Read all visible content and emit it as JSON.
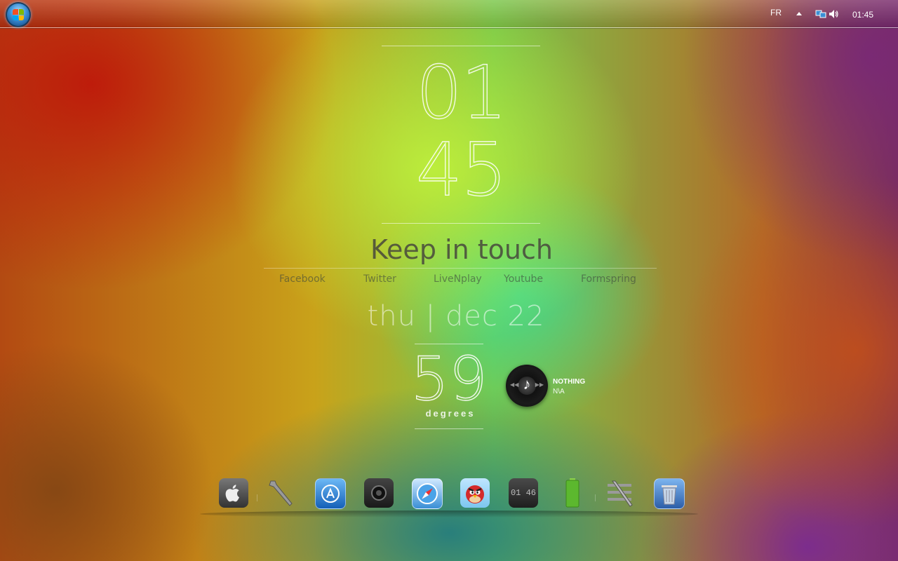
{
  "taskbar": {
    "language": "FR",
    "clock": "01:45",
    "icons": [
      "show-hidden-icons-arrow-icon",
      "network-icon",
      "volume-icon"
    ]
  },
  "clock": {
    "hours": "01",
    "minutes": "45"
  },
  "social": {
    "title": "Keep in touch",
    "links": [
      "Facebook",
      "Twitter",
      "LiveNplay",
      "Youtube",
      "Formspring"
    ]
  },
  "date": {
    "text": "thu  |  dec 22"
  },
  "weather": {
    "temperature": "59",
    "unit": "degrees"
  },
  "music": {
    "title": "NOTHING",
    "artist": "N\\A"
  },
  "dock": {
    "items": [
      "apple-icon",
      "wrench-icon",
      "app-store-icon",
      "camera-icon",
      "safari-compass-icon",
      "angry-birds-icon",
      "clock-widget-icon",
      "battery-icon",
      "settings-tools-icon",
      "trash-icon"
    ],
    "clock_widget_text": "01 46"
  },
  "colors": {
    "accent_text": "#ffffff",
    "muted_text": "#4a4a3c"
  }
}
